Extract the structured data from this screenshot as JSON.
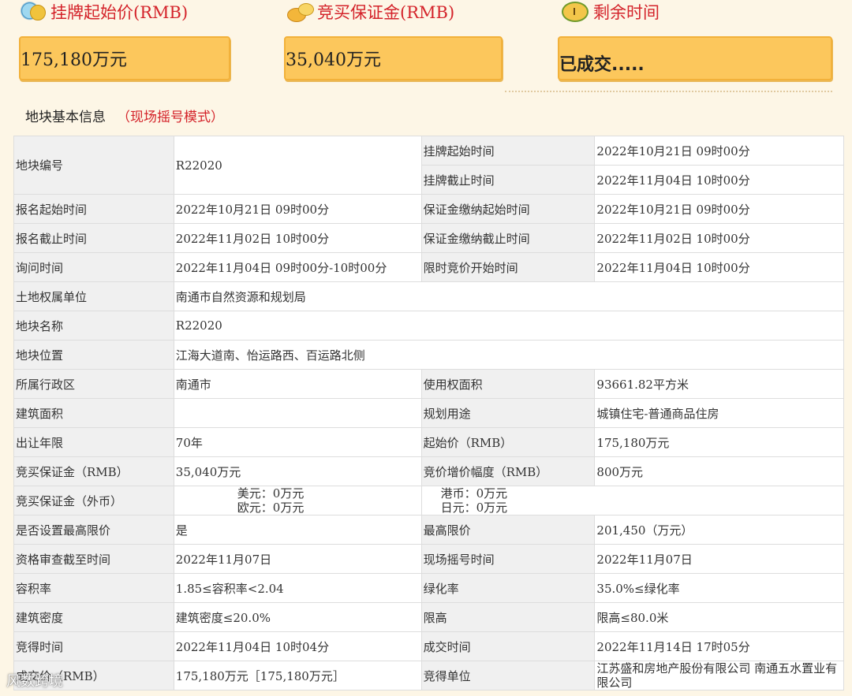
{
  "top": {
    "start_price_label": "挂牌起始价(RMB)",
    "deposit_label": "竞买保证金(RMB)",
    "time_left_label": "剩余时间",
    "start_price_value": "175,180万元",
    "deposit_value": "35,040万元",
    "time_left_value": "已成交....."
  },
  "section": {
    "title": "地块基本信息",
    "mode": "（现场摇号模式）"
  },
  "table": {
    "r1": {
      "l1": "地块编号",
      "v1": "R22020",
      "l2a": "挂牌起始时间",
      "v2a": "2022年10月21日 09时00分",
      "l2b": "挂牌截止时间",
      "v2b": "2022年11月04日 10时00分"
    },
    "r2": {
      "l1": "报名起始时间",
      "v1": "2022年10月21日 09时00分",
      "l2": "保证金缴纳起始时间",
      "v2": "2022年10月21日 09时00分"
    },
    "r3": {
      "l1": "报名截止时间",
      "v1": "2022年11月02日 10时00分",
      "l2": "保证金缴纳截止时间",
      "v2": "2022年11月02日 10时00分"
    },
    "r4": {
      "l1": "询问时间",
      "v1": "2022年11月04日 09时00分-10时00分",
      "l2": "限时竞价开始时间",
      "v2": "2022年11月04日 10时00分"
    },
    "r5": {
      "l1": "土地权属单位",
      "v1": "南通市自然资源和规划局"
    },
    "r6": {
      "l1": "地块名称",
      "v1": "R22020"
    },
    "r7": {
      "l1": "地块位置",
      "v1": "江海大道南、怡运路西、百运路北侧"
    },
    "r8": {
      "l1": "所属行政区",
      "v1": "南通市",
      "l2": "使用权面积",
      "v2": "93661.82平方米"
    },
    "r9": {
      "l1": "建筑面积",
      "v1": "",
      "l2": "规划用途",
      "v2": "城镇住宅-普通商品住房"
    },
    "r10": {
      "l1": "出让年限",
      "v1": "70年",
      "l2": "起始价（RMB）",
      "v2": "175,180万元"
    },
    "r11": {
      "l1": "竞买保证金（RMB）",
      "v1": "35,040万元",
      "l2": "竞价增价幅度（RMB）",
      "v2": "800万元"
    },
    "r12": {
      "l1": "竞买保证金（外币）",
      "usd": "美元：0万元",
      "eur": "欧元：0万元",
      "hkd": "港币：0万元",
      "jpy": "日元：0万元"
    },
    "r13": {
      "l1": "是否设置最高限价",
      "v1": "是",
      "l2": "最高限价",
      "v2": "201,450（万元）"
    },
    "r14": {
      "l1": "资格审查截至时间",
      "v1": "2022年11月07日",
      "l2": "现场摇号时间",
      "v2": "2022年11月07日"
    },
    "r15": {
      "l1": "容积率",
      "v1": "1.85≤容积率<2.04",
      "l2": "绿化率",
      "v2": "35.0%≤绿化率"
    },
    "r16": {
      "l1": "建筑密度",
      "v1": "建筑密度≤20.0%",
      "l2": "限高",
      "v2": "限高≤80.0米"
    },
    "r17": {
      "l1": "竞得时间",
      "v1": "2022年11月04日 10时04分",
      "l2": "成交时间",
      "v2": "2022年11月14日 17时05分"
    },
    "r18": {
      "l1": "成交价（RMB）",
      "v1": "175,180万元［175,180万元］",
      "l2": "竞得单位",
      "v2": "江苏盛和房地产股份有限公司 南通五水置业有限公司"
    }
  },
  "watermark": "风数跨境"
}
